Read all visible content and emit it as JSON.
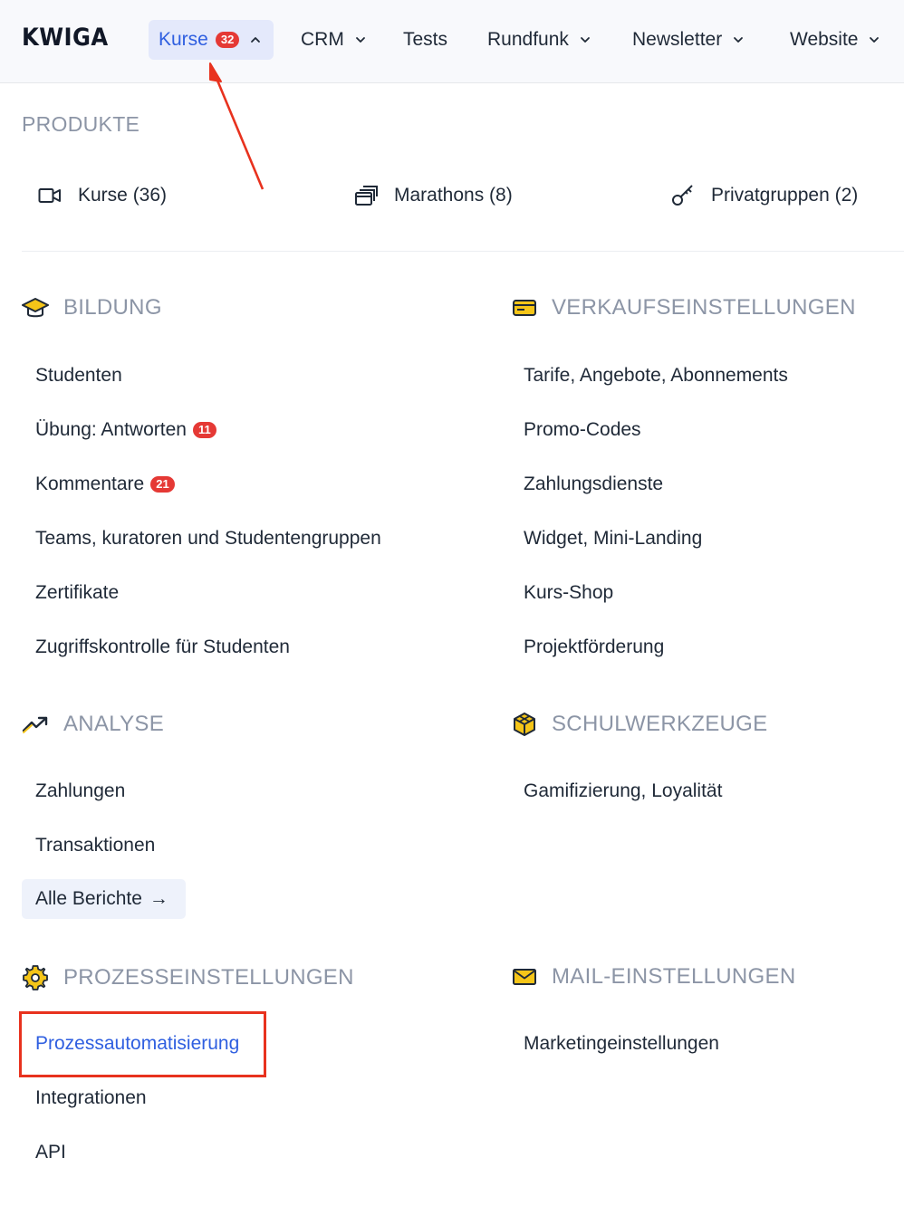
{
  "logo": "KWIGA",
  "nav": {
    "kurse": "Kurse",
    "kurse_badge": "32",
    "crm": "CRM",
    "tests": "Tests",
    "rundfunk": "Rundfunk",
    "newsletter": "Newsletter",
    "website": "Website"
  },
  "produkte": {
    "label": "PRODUKTE",
    "kurse": "Kurse (36)",
    "marathons": "Marathons (8)",
    "privatgruppen": "Privatgruppen (2)"
  },
  "bildung": {
    "title": "BILDUNG",
    "studenten": "Studenten",
    "uebung": "Übung: Antworten",
    "uebung_badge": "11",
    "kommentare": "Kommentare",
    "kommentare_badge": "21",
    "teams": "Teams, kuratoren und Studentengruppen",
    "zertifikate": "Zertifikate",
    "zugriff": "Zugriffskontrolle für Studenten"
  },
  "verkauf": {
    "title": "VERKAUFSEINSTELLUNGEN",
    "tarife": "Tarife, Angebote, Abonnements",
    "promo": "Promo-Codes",
    "zahlungsdienste": "Zahlungsdienste",
    "widget": "Widget, Mini-Landing",
    "shop": "Kurs-Shop",
    "foerderung": "Projektförderung"
  },
  "analyse": {
    "title": "ANALYSE",
    "zahlungen": "Zahlungen",
    "transaktionen": "Transaktionen",
    "alle_berichte": "Alle Berichte",
    "arrow": "→"
  },
  "schulwerkzeuge": {
    "title": "SCHULWERKZEUGE",
    "gamifizierung": "Gamifizierung, Loyalität"
  },
  "prozess": {
    "title": "PROZESSEINSTELLUNGEN",
    "automatisierung": "Prozessautomatisierung",
    "integrationen": "Integrationen",
    "api": "API"
  },
  "mail": {
    "title": "MAIL-EINSTELLUNGEN",
    "marketing": "Marketingeinstellungen"
  },
  "colors": {
    "accent": "#2f5fe0",
    "badge": "#e53935",
    "annotation": "#e8321e",
    "icon_yellow": "#f5c518",
    "muted": "#8c95a6"
  }
}
